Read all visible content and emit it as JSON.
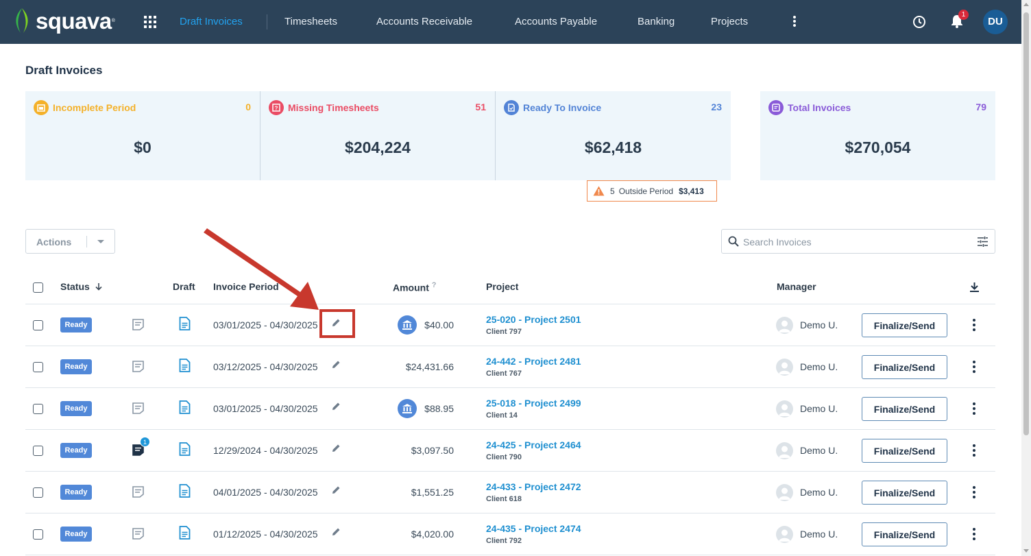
{
  "nav": {
    "logo": "squava",
    "items": [
      {
        "label": "Draft Invoices",
        "active": true
      },
      {
        "label": "Timesheets"
      },
      {
        "label": "Accounts Receivable"
      },
      {
        "label": "Accounts Payable"
      },
      {
        "label": "Banking"
      },
      {
        "label": "Projects"
      }
    ],
    "notification_count": "1",
    "user_initials": "DU"
  },
  "page": {
    "title": "Draft Invoices"
  },
  "cards": [
    {
      "label": "Incomplete Period",
      "count": "0",
      "value": "$0",
      "color": "#f4b12a"
    },
    {
      "label": "Missing Timesheets",
      "count": "51",
      "value": "$204,224",
      "color": "#ea4c64"
    },
    {
      "label": "Ready To Invoice",
      "count": "23",
      "value": "$62,418",
      "color": "#5283d6"
    },
    {
      "label": "Total Invoices",
      "count": "79",
      "value": "$270,054",
      "color": "#8a5bd8"
    }
  ],
  "outside_period": {
    "count": "5",
    "label": "Outside Period",
    "amount": "$3,413"
  },
  "toolbar": {
    "actions_label": "Actions",
    "search_placeholder": "Search Invoices"
  },
  "table": {
    "headers": {
      "status": "Status",
      "draft": "Draft",
      "period": "Invoice Period",
      "amount": "Amount",
      "help": "?",
      "project": "Project",
      "manager": "Manager"
    },
    "rows": [
      {
        "status": "Ready",
        "period": "03/01/2025 - 04/30/2025",
        "bank": true,
        "amount": "$40.00",
        "project": "25-020 - Project 2501",
        "client": "Client 797",
        "manager": "Demo U.",
        "button": "Finalize/Send",
        "note_active": false
      },
      {
        "status": "Ready",
        "period": "03/12/2025 - 04/30/2025",
        "bank": false,
        "amount": "$24,431.66",
        "project": "24-442 - Project 2481",
        "client": "Client 767",
        "manager": "Demo U.",
        "button": "Finalize/Send",
        "note_active": false
      },
      {
        "status": "Ready",
        "period": "03/01/2025 - 04/30/2025",
        "bank": true,
        "amount": "$88.95",
        "project": "25-018 - Project 2499",
        "client": "Client 14",
        "manager": "Demo U.",
        "button": "Finalize/Send",
        "note_active": false
      },
      {
        "status": "Ready",
        "period": "12/29/2024 - 04/30/2025",
        "bank": false,
        "amount": "$3,097.50",
        "project": "24-425 - Project 2464",
        "client": "Client 790",
        "manager": "Demo U.",
        "button": "Finalize/Send",
        "note_active": true,
        "note_count": "1"
      },
      {
        "status": "Ready",
        "period": "04/01/2025 - 04/30/2025",
        "bank": false,
        "amount": "$1,551.25",
        "project": "24-433 - Project 2472",
        "client": "Client 618",
        "manager": "Demo U.",
        "button": "Finalize/Send",
        "note_active": false
      },
      {
        "status": "Ready",
        "period": "01/12/2025 - 04/30/2025",
        "bank": false,
        "amount": "$4,020.00",
        "project": "24-435 - Project 2474",
        "client": "Client 792",
        "manager": "Demo U.",
        "button": "Finalize/Send",
        "note_active": false
      }
    ]
  },
  "colors": {
    "nav_bg": "#2c4359",
    "accent": "#22a3f0",
    "status_ready": "#5188d8",
    "link": "#1e8fd0",
    "highlight": "#c8382d"
  }
}
